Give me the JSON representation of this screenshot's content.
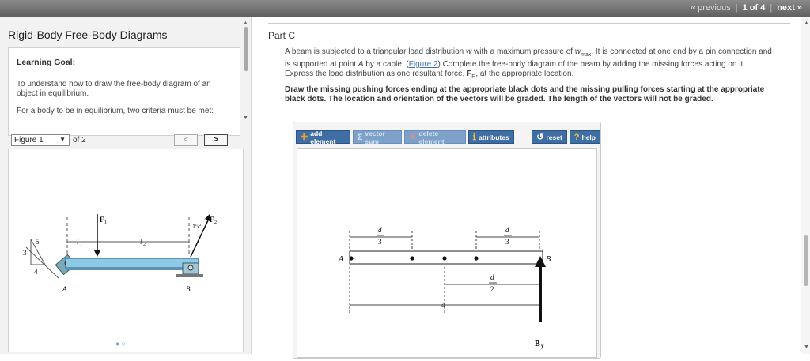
{
  "pager": {
    "previous": "« previous",
    "position": "1 of 4",
    "next": "next »"
  },
  "sidebar": {
    "title": "Rigid-Body Free-Body Diagrams",
    "goal_heading": "Learning Goal:",
    "goal_text_1": "To understand how to draw the free-body diagram of an object in equilibrium.",
    "goal_text_2": "For a body to be in equilibrium, two criteria must be met:"
  },
  "figure": {
    "select_value": "Figure 1",
    "of_label": "of 2",
    "prev_label": "<",
    "next_label": ">",
    "labels": {
      "F1": "F",
      "F1_sub": "1",
      "F2": "F",
      "F2_sub": "2",
      "angle": "15°",
      "l1": "l",
      "l1_sub": "1",
      "l2": "l",
      "l2_sub": "2",
      "A": "A",
      "B": "B",
      "five": "5",
      "three": "3",
      "four": "4"
    }
  },
  "part": {
    "title": "Part C",
    "desc_1": "A beam is subjected to a triangular load distribution ",
    "w": "w",
    "desc_2": " with a maximum pressure of ",
    "wmax": "w",
    "wmax_sub": "max",
    "desc_3": ". It is connected at one end by a pin connection and is supported at point ",
    "pointA": "A",
    "desc_4": " by a cable. (",
    "figure_link": "Figure 2",
    "desc_5": ") Complete the free-body diagram of the beam by adding the missing forces acting on it. Express the load distribution as one resultant force, ",
    "FR": "F",
    "FR_sub": "R",
    "desc_6": ", at the appropriate location.",
    "instructions": "Draw the missing pushing forces ending at the appropriate black dots and the missing pulling forces starting at the appropriate black dots. The location and orientation of the vectors will be graded. The length of the vectors will not be graded."
  },
  "toolbar": {
    "add_element": "add element",
    "vector_sum": "vector sum",
    "delete_element": "delete element",
    "attributes": "attributes",
    "reset": "reset",
    "help": "help"
  },
  "canvas": {
    "d": "d",
    "three": "3",
    "two": "2",
    "A": "A",
    "B": "B",
    "By": "B",
    "By_sub": "y"
  },
  "colors": {
    "toolbar_blue": "#3f6ea5",
    "beam_blue": "#8ec9e6",
    "link": "#3b6fb6"
  }
}
